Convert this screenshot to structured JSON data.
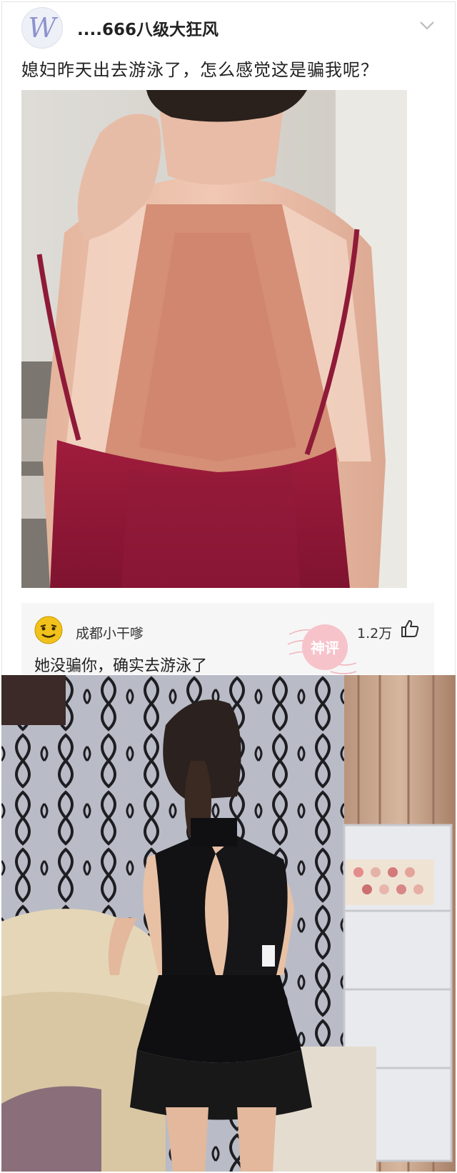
{
  "post": {
    "username": "....666八级大狂风",
    "avatar_letter": "W",
    "text": "媳妇昨天出去游泳了，怎么感觉这是骗我呢？"
  },
  "comment": {
    "username": "成都小干嗲",
    "stamp": "神评",
    "likes": "1.2万",
    "text": "她没骗你，确实去游泳了"
  },
  "colors": {
    "accent_red": "#e0576a",
    "background": "#ffffff",
    "comment_bg": "#f6f6f6"
  },
  "icons": [
    "chevron-down-icon",
    "thumbs-up-icon",
    "emoji-face-icon"
  ]
}
